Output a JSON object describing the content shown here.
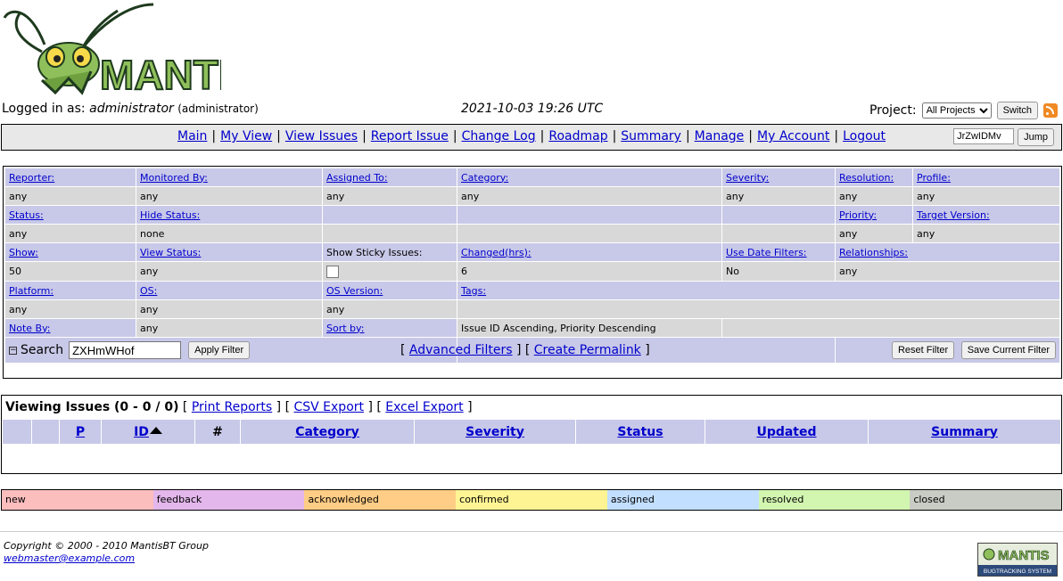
{
  "logo": {
    "text": "MANTIS"
  },
  "login": {
    "prefix": "Logged in as: ",
    "username": "administrator",
    "role": "(administrator)",
    "datetime": "2021-10-03 19:26 UTC",
    "project_label": "Project:",
    "project_value": "All Projects",
    "switch_label": "Switch"
  },
  "menu": {
    "items": [
      "Main",
      "My View",
      "View Issues",
      "Report Issue",
      "Change Log",
      "Roadmap",
      "Summary",
      "Manage",
      "My Account",
      "Logout"
    ],
    "jump_value": "JrZwIDMv",
    "jump_label": "Jump"
  },
  "filters": {
    "reporter": "Reporter:",
    "reporter_v": "any",
    "monitored": "Monitored By:",
    "monitored_v": "any",
    "assigned": "Assigned To:",
    "assigned_v": "any",
    "category": "Category:",
    "category_v": "any",
    "severity": "Severity:",
    "severity_v": "any",
    "resolution": "Resolution:",
    "resolution_v": "any",
    "profile": "Profile:",
    "profile_v": "any",
    "status": "Status:",
    "status_v": "any",
    "hide_status": "Hide Status:",
    "hide_status_v": "none",
    "priority": "Priority:",
    "priority_v": "any",
    "target": "Target Version:",
    "target_v": "any",
    "show": "Show:",
    "show_v": "50",
    "view_status": "View Status:",
    "view_status_v": "any",
    "sticky": "Show Sticky Issues:",
    "changed": "Changed(hrs):",
    "changed_v": "6",
    "date_filters": "Use Date Filters:",
    "date_filters_v": "No",
    "relationships": "Relationships:",
    "relationships_v": "any",
    "platform": "Platform:",
    "platform_v": "any",
    "os": "OS:",
    "os_v": "any",
    "os_version": "OS Version:",
    "os_version_v": "any",
    "tags": "Tags:",
    "note_by": "Note By:",
    "note_by_v": "any",
    "sort_by": "Sort by:",
    "sort_by_v": "Issue ID Ascending, Priority Descending",
    "search_label": "Search",
    "search_value": "ZXHmWHof",
    "apply": "Apply Filter",
    "advanced": "Advanced Filters",
    "permalink": "Create Permalink",
    "reset": "Reset Filter",
    "save": "Save Current Filter"
  },
  "issues": {
    "title": "Viewing Issues (0 - 0 / 0)",
    "print": "Print Reports",
    "csv": "CSV Export",
    "excel": "Excel Export",
    "columns": [
      "",
      "",
      "P",
      "ID",
      "#",
      "Category",
      "Severity",
      "Status",
      "Updated",
      "Summary"
    ]
  },
  "legend": [
    {
      "label": "new",
      "color": "#fcbdbd"
    },
    {
      "label": "feedback",
      "color": "#e3b7eb"
    },
    {
      "label": "acknowledged",
      "color": "#ffcd85"
    },
    {
      "label": "confirmed",
      "color": "#fff494"
    },
    {
      "label": "assigned",
      "color": "#c2dfff"
    },
    {
      "label": "resolved",
      "color": "#d2f5b0"
    },
    {
      "label": "closed",
      "color": "#c9ccc4"
    }
  ],
  "footer": {
    "copyright": "Copyright © 2000 - 2010 MantisBT Group",
    "email": "webmaster@example.com",
    "badge_top": "MANTIS",
    "badge_bottom": "BUGTRACKING SYSTEM"
  }
}
